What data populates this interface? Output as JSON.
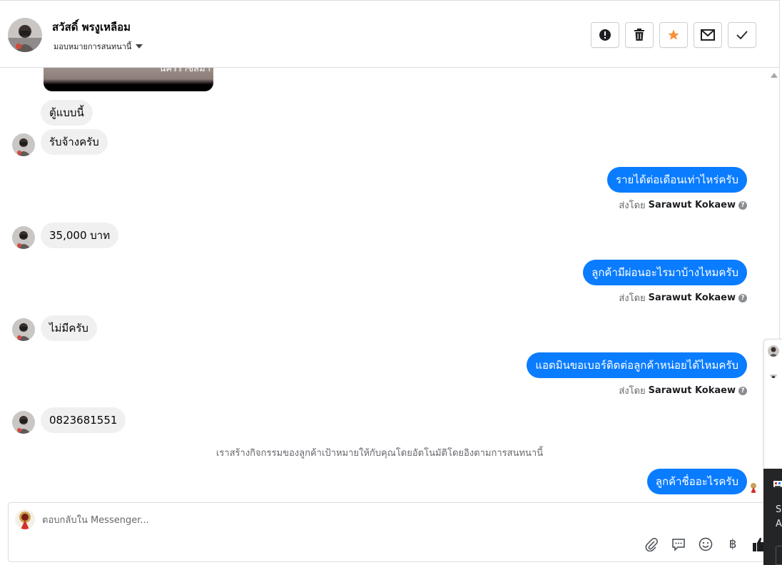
{
  "header": {
    "contact_name": "สวัสดิ์ พรงูเหลือม",
    "assign_label": "มอบหมายการสนทนานี้",
    "actions": [
      "mark-spam",
      "delete",
      "star",
      "mark-unread",
      "done"
    ]
  },
  "thread": {
    "photo_caption": "นครราชสีมา",
    "messages": [
      {
        "dir": "in",
        "text": "ตู้แบบนี้"
      },
      {
        "dir": "in",
        "text": "รับจ้างครับ"
      },
      {
        "dir": "out",
        "text": "รายได้ต่อเดือนเท่าไหร่ครับ",
        "sent_by_prefix": "ส่งโดย",
        "sender": "Sarawut Kokaew"
      },
      {
        "dir": "in",
        "text": "35,000 บาท"
      },
      {
        "dir": "out",
        "text": "ลูกค้ามีผ่อนอะไรมาบ้างไหมครับ",
        "sent_by_prefix": "ส่งโดย",
        "sender": "Sarawut Kokaew"
      },
      {
        "dir": "in",
        "text": "ไม่มีครับ"
      },
      {
        "dir": "out",
        "text": "แอดมินขอเบอร์ติดต่อลูกค้าหน่อยได้ไหมครับ",
        "sent_by_prefix": "ส่งโดย",
        "sender": "Sarawut Kokaew"
      },
      {
        "dir": "in",
        "text": "0823681551"
      },
      {
        "dir": "system",
        "text": "เราสร้างกิจกรรมของลูกค้าเป้าหมายให้กับคุณโดยอัตโนมัติโดยอิงตามการสนทนานี้"
      },
      {
        "dir": "out",
        "text": "ลูกค้าชื่ออะไรครับ"
      }
    ]
  },
  "composer": {
    "placeholder": "ตอบกลับใน Messenger...",
    "tools": [
      "attachment-icon",
      "saved-reply-icon",
      "emoji-icon",
      "baht-icon",
      "thumbs-up-icon"
    ]
  },
  "side": {
    "text_1": "Se",
    "text_2": "A"
  },
  "colors": {
    "outgoing_bubble": "#0a7cff",
    "incoming_bubble": "#f0f0f0",
    "star": "#f7923b"
  }
}
